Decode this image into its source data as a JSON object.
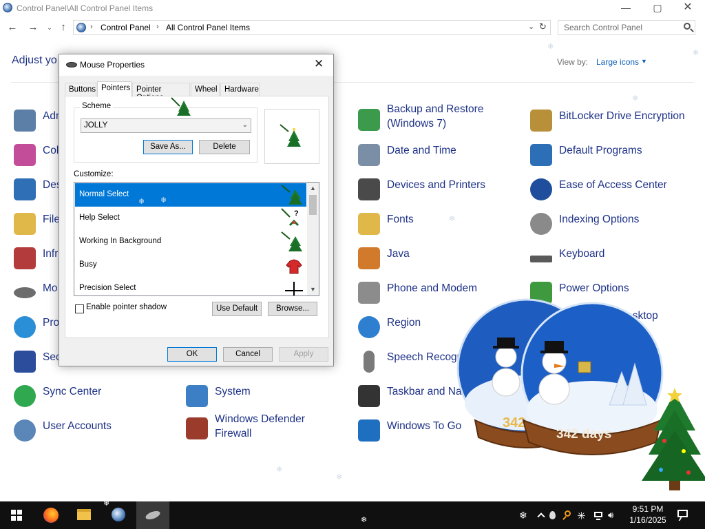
{
  "window": {
    "title": "Control Panel\\All Control Panel Items",
    "controls": {
      "minimize": "—",
      "maximize": "▢",
      "close": "✕"
    }
  },
  "address": {
    "crumbs": [
      "Control Panel",
      "All Control Panel Items"
    ],
    "search_placeholder": "Search Control Panel"
  },
  "header": {
    "adjust_text": "Adjust yo",
    "view_by_label": "View by:",
    "view_by_value": "Large icons"
  },
  "items": [
    {
      "label": "Adm",
      "color": "#5b7fa6"
    },
    {
      "label": "Col",
      "color": "#c44d9a"
    },
    {
      "label": "Des",
      "color": "#2f6fb5"
    },
    {
      "label": "File",
      "color": "#e0b84a"
    },
    {
      "label": "Infr",
      "color": "#b33b3b"
    },
    {
      "label": "Mo",
      "color": "#6c6c6c"
    },
    {
      "label": "Pro",
      "color": "#2a8fd6"
    },
    {
      "label": "Sec",
      "color": "#2c4c9c"
    },
    {
      "label": "Sync Center",
      "color": "#2fa84f"
    },
    {
      "label": "User Accounts",
      "color": "#5a86b8"
    },
    {
      "label": "System",
      "color": "#3d7fc4"
    },
    {
      "label": "Windows Defender Firewall",
      "color": "#9b3b2b"
    },
    {
      "label": "Backup and Restore (Windows 7)",
      "color": "#3c9a4d"
    },
    {
      "label": "Date and Time",
      "color": "#7a8fa6"
    },
    {
      "label": "Devices and Printers",
      "color": "#4a4a4a"
    },
    {
      "label": "Fonts",
      "color": "#e0b84a"
    },
    {
      "label": "Java",
      "color": "#d27a2c"
    },
    {
      "label": "Phone and Modem",
      "color": "#8c8c8c"
    },
    {
      "label": "Region",
      "color": "#2f7fd0"
    },
    {
      "label": "Speech Recogniti",
      "color": "#7a7a7a"
    },
    {
      "label": "Taskbar and Naviga",
      "color": "#333333"
    },
    {
      "label": "Windows To Go",
      "color": "#1f6fc0"
    },
    {
      "label": "BitLocker Drive Encryption",
      "color": "#b8903a"
    },
    {
      "label": "Default Programs",
      "color": "#2d6fb6"
    },
    {
      "label": "Ease of Access Center",
      "color": "#1f4f9c"
    },
    {
      "label": "Indexing Options",
      "color": "#8a8a8a"
    },
    {
      "label": "Keyboard",
      "color": "#5a5a5a"
    },
    {
      "label": "Power Options",
      "color": "#3f9a3f"
    },
    {
      "label": "d Desktop",
      "color": "#3d7fc4"
    }
  ],
  "dialog": {
    "title": "Mouse Properties",
    "tabs": [
      "Buttons",
      "Pointers",
      "Pointer Options",
      "Wheel",
      "Hardware"
    ],
    "active_tab": "Pointers",
    "scheme": {
      "legend": "Scheme",
      "value": "JOLLY",
      "save_as": "Save As...",
      "delete": "Delete"
    },
    "customize_label": "Customize:",
    "cursors": [
      {
        "label": "Normal Select",
        "selected": true
      },
      {
        "label": "Help Select",
        "selected": false
      },
      {
        "label": "Working In Background",
        "selected": false
      },
      {
        "label": "Busy",
        "selected": false
      },
      {
        "label": "Precision Select",
        "selected": false
      }
    ],
    "shadow_label": "Enable pointer shadow",
    "use_default": "Use Default",
    "browse": "Browse...",
    "ok": "OK",
    "cancel": "Cancel",
    "apply": "Apply"
  },
  "desktop": {
    "counter_text": "342 days"
  },
  "taskbar": {
    "time": "9:51 PM",
    "date": "1/16/2025"
  }
}
